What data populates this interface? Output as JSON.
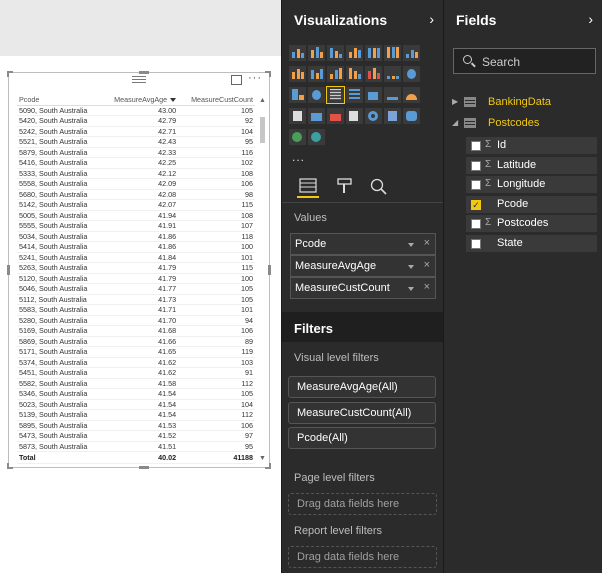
{
  "visual": {
    "columns": [
      "Pcode",
      "MeasureAvgAge",
      "MeasureCustCount"
    ],
    "sorted_column": "MeasureAvgAge",
    "rows": [
      [
        "5090, South Australia",
        "43.00",
        "105"
      ],
      [
        "5420, South Australia",
        "42.79",
        "92"
      ],
      [
        "5242, South Australia",
        "42.71",
        "104"
      ],
      [
        "5521, South Australia",
        "42.43",
        "95"
      ],
      [
        "5879, South Australia",
        "42.33",
        "116"
      ],
      [
        "5416, South Australia",
        "42.25",
        "102"
      ],
      [
        "5333, South Australia",
        "42.12",
        "108"
      ],
      [
        "5558, South Australia",
        "42.09",
        "106"
      ],
      [
        "5680, South Australia",
        "42.08",
        "98"
      ],
      [
        "5142, South Australia",
        "42.07",
        "115"
      ],
      [
        "5005, South Australia",
        "41.94",
        "108"
      ],
      [
        "5555, South Australia",
        "41.91",
        "107"
      ],
      [
        "5034, South Australia",
        "41.86",
        "118"
      ],
      [
        "5414, South Australia",
        "41.86",
        "100"
      ],
      [
        "5241, South Australia",
        "41.84",
        "101"
      ],
      [
        "5263, South Australia",
        "41.79",
        "115"
      ],
      [
        "5120, South Australia",
        "41.79",
        "100"
      ],
      [
        "5046, South Australia",
        "41.77",
        "105"
      ],
      [
        "5112, South Australia",
        "41.73",
        "105"
      ],
      [
        "5583, South Australia",
        "41.71",
        "101"
      ],
      [
        "5280, South Australia",
        "41.70",
        "94"
      ],
      [
        "5169, South Australia",
        "41.68",
        "106"
      ],
      [
        "5869, South Australia",
        "41.66",
        "89"
      ],
      [
        "5171, South Australia",
        "41.65",
        "119"
      ],
      [
        "5374, South Australia",
        "41.62",
        "103"
      ],
      [
        "5451, South Australia",
        "41.62",
        "91"
      ],
      [
        "5582, South Australia",
        "41.58",
        "112"
      ],
      [
        "5346, South Australia",
        "41.54",
        "105"
      ],
      [
        "5023, South Australia",
        "41.54",
        "104"
      ],
      [
        "5139, South Australia",
        "41.54",
        "112"
      ],
      [
        "5895, South Australia",
        "41.53",
        "106"
      ],
      [
        "5473, South Australia",
        "41.52",
        "97"
      ],
      [
        "5873, South Australia",
        "41.51",
        "95"
      ]
    ],
    "total": {
      "label": "Total",
      "avg_age": "40.02",
      "cust_count": "41188"
    },
    "more_label": "···"
  },
  "visualizations": {
    "title": "Visualizations",
    "more_label": "...",
    "values_label": "Values",
    "value_wells": [
      "Pcode",
      "MeasureAvgAge",
      "MeasureCustCount"
    ],
    "remove_glyph": "×"
  },
  "filters": {
    "title": "Filters",
    "visual_level_label": "Visual level filters",
    "visual_filters": [
      "MeasureAvgAge(All)",
      "MeasureCustCount(All)",
      "Pcode(All)"
    ],
    "page_level_label": "Page level filters",
    "report_level_label": "Report level filters",
    "drop_hint": "Drag data fields here"
  },
  "fields": {
    "title": "Fields",
    "search_placeholder": "Search",
    "tables": [
      {
        "name": "BankingData",
        "expanded": false
      },
      {
        "name": "Postcodes",
        "expanded": true
      }
    ],
    "postcode_fields": [
      {
        "name": "Id",
        "sigma": true,
        "checked": false
      },
      {
        "name": "Latitude",
        "sigma": true,
        "checked": false
      },
      {
        "name": "Longitude",
        "sigma": true,
        "checked": false
      },
      {
        "name": "Pcode",
        "sigma": false,
        "checked": true
      },
      {
        "name": "Postcodes",
        "sigma": true,
        "checked": false
      },
      {
        "name": "State",
        "sigma": false,
        "checked": false
      }
    ],
    "sigma_glyph": "Σ",
    "check_glyph": "✓",
    "expand_glyph": "▶",
    "collapse_glyph": "◢"
  },
  "colors": {
    "accent": "#f2c811",
    "pane_bg": "#2b2b2b"
  }
}
